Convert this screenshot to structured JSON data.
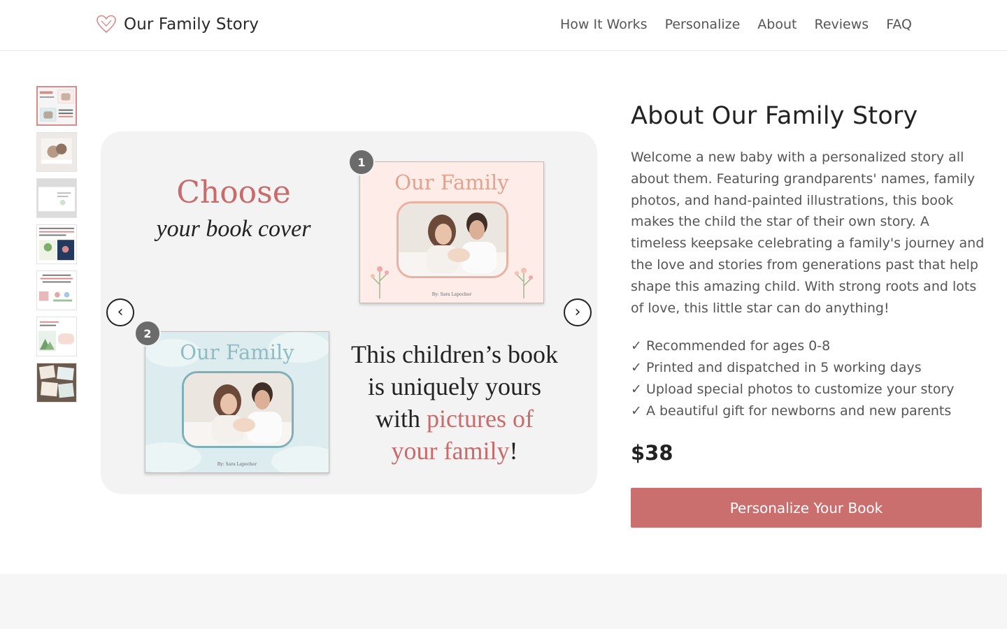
{
  "brand": {
    "name": "Our Family Story",
    "icon": "heart-outline-icon",
    "accent": "#cb6e6e"
  },
  "nav": [
    {
      "label": "How It Works"
    },
    {
      "label": "Personalize"
    },
    {
      "label": "About"
    },
    {
      "label": "Reviews"
    },
    {
      "label": "FAQ"
    }
  ],
  "gallery": {
    "thumbnail_count": 7,
    "active_index": 0,
    "slide": {
      "heading": "Choose",
      "subheading": "your book cover",
      "cover1": {
        "badge": "1",
        "title": "Our Family",
        "byline": "By: Sara Lapocher"
      },
      "cover2": {
        "badge": "2",
        "title": "Our Family",
        "byline": "By: Sara Lapocher"
      },
      "text_before": "This children’s book is uniquely yours with ",
      "text_highlight": "pictures of your family",
      "text_after": "!"
    },
    "prev_label": "‹",
    "next_label": "›"
  },
  "product": {
    "title": "About Our Family Story",
    "description": "Welcome a new baby with a personalized story all about them. Featuring grandparents' names, family photos, and hand-painted illustrations, this book makes the child the star of their own story. A timeless keepsake celebrating a family's journey and the love and stories from generations past that help shape this amazing child. With strong roots and lots of love, this little star can do anything!",
    "features": [
      "✓ Recommended for ages 0-8",
      "✓ Printed and dispatched in 5 working days",
      "✓ Upload special photos to customize your story",
      "✓ A beautiful gift for newborns and new parents"
    ],
    "price": "$38",
    "cta_label": "Personalize Your Book"
  }
}
